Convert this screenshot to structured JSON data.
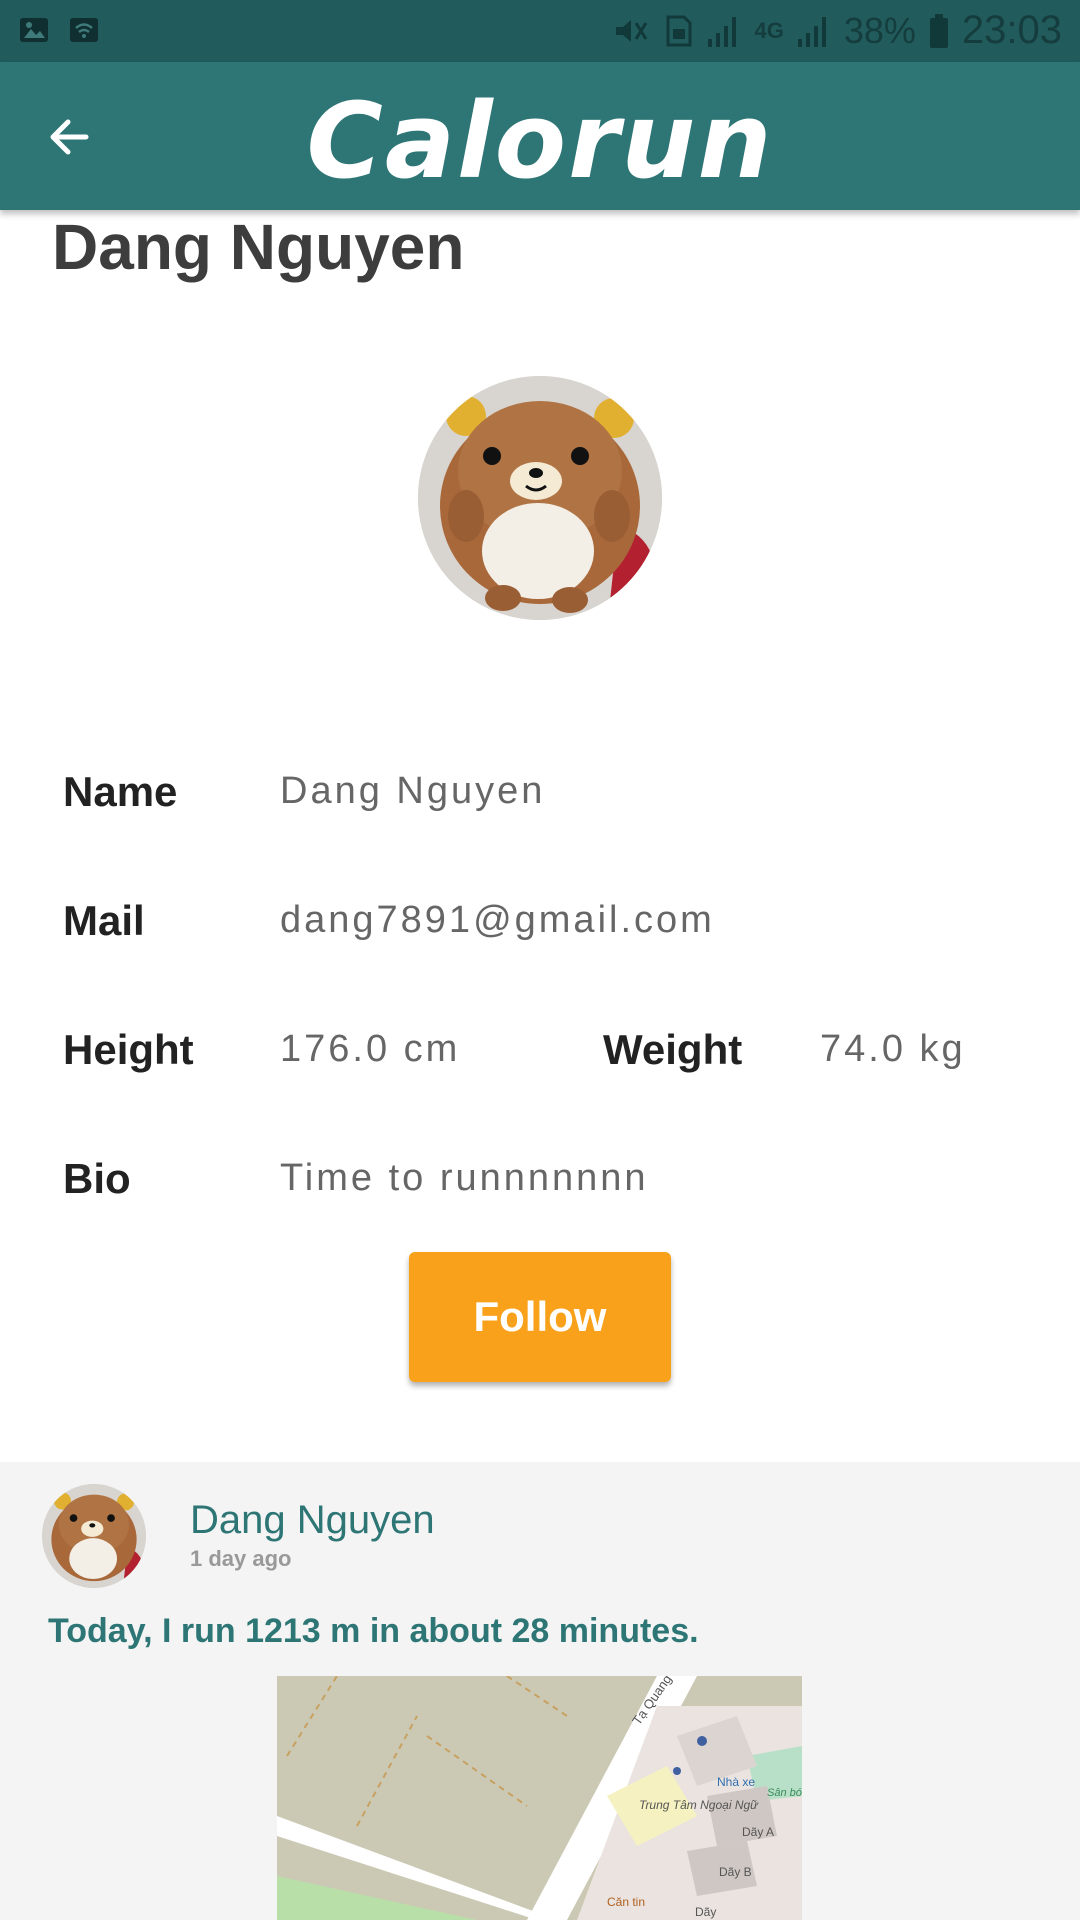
{
  "status_bar": {
    "battery": "38%",
    "time": "23:03",
    "network": "4G",
    "icons": [
      "image-icon",
      "wifi-icon",
      "mute-icon",
      "sim-icon",
      "signal-icon",
      "battery-icon"
    ]
  },
  "app_bar": {
    "brand": "Calorun",
    "back_icon": "arrow-left-icon"
  },
  "profile": {
    "title": "Dang Nguyen",
    "fields": {
      "name_label": "Name",
      "name_value": "Dang Nguyen",
      "mail_label": "Mail",
      "mail_value": "dang7891@gmail.com",
      "height_label": "Height",
      "height_value": "176.0 cm",
      "weight_label": "Weight",
      "weight_value": "74.0 kg",
      "bio_label": "Bio",
      "bio_value": "Time to runnnnnnn"
    },
    "follow_label": "Follow"
  },
  "feed": {
    "post": {
      "user": "Dang Nguyen",
      "time": "1 day ago",
      "text": "Today, I run 1213 m in about 28 minutes.",
      "map_labels": {
        "street": "Tạ Quang",
        "parking": "Nhà xe",
        "building": "Trung Tâm Ngoại Ngữ",
        "canteen": "Căn tin",
        "block_a": "Dãy A",
        "block_b": "Dãy B",
        "block_c": "Dãy",
        "yard": "Sân bó đá"
      }
    }
  },
  "colors": {
    "status_bar": "#215b5c",
    "app_bar": "#2d7675",
    "accent": "#f9a11b",
    "feed_bg": "#f4f4f4"
  }
}
